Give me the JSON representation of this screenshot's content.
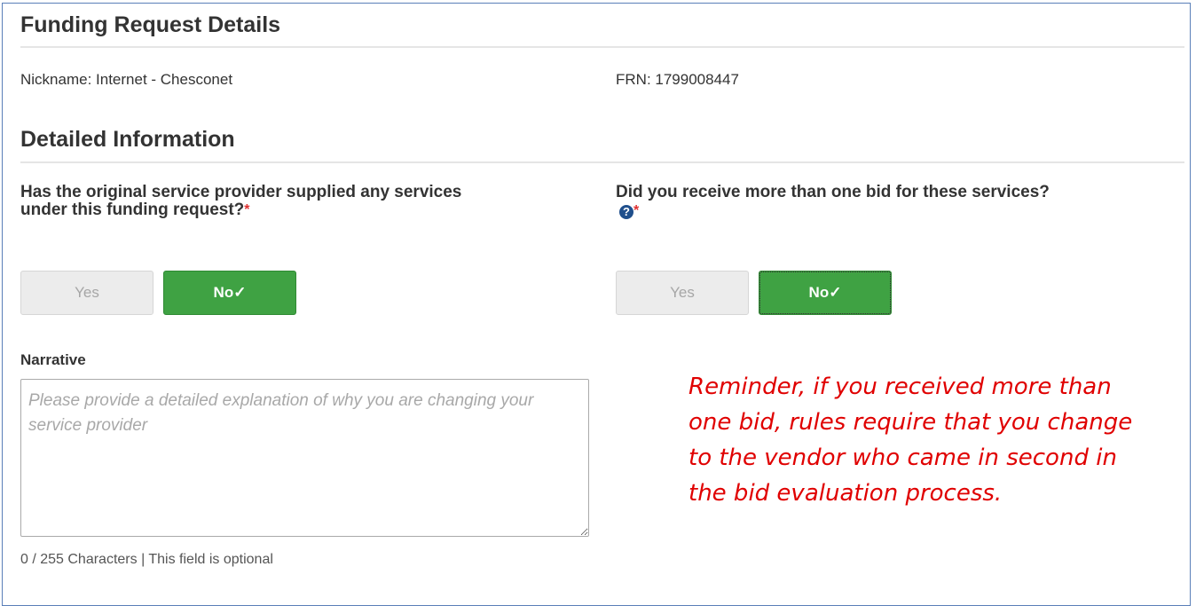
{
  "funding_request": {
    "title": "Funding Request Details",
    "nickname": "Nickname: Internet - Chesconet",
    "frn": "FRN: 1799008447"
  },
  "detailed_info": {
    "title": "Detailed Information",
    "q1": {
      "line1": "Has the original service provider supplied any services",
      "line2": "under this funding request?",
      "required_mark": "*",
      "yes_label": "Yes",
      "no_label": "No✓",
      "selected": "No"
    },
    "q2": {
      "line1": "Did you receive more than one bid for these services?",
      "help_icon": "?",
      "required_mark": "*",
      "yes_label": "Yes",
      "no_label": "No✓",
      "selected": "No"
    }
  },
  "narrative": {
    "label": "Narrative",
    "placeholder": "Please provide a detailed explanation of why you are changing your service provider",
    "value": "",
    "counter": "0 / 255 Characters | This field is optional"
  },
  "reminder": {
    "text": "Reminder, if you received more than one bid, rules require that you change to the vendor who came in second in the bid evaluation process."
  },
  "colors": {
    "accent_green": "#3fa243",
    "required_red": "#e03030",
    "reminder_red": "#e00000",
    "help_icon_blue": "#1f4f8c",
    "frame_border": "#5a7fb8"
  }
}
